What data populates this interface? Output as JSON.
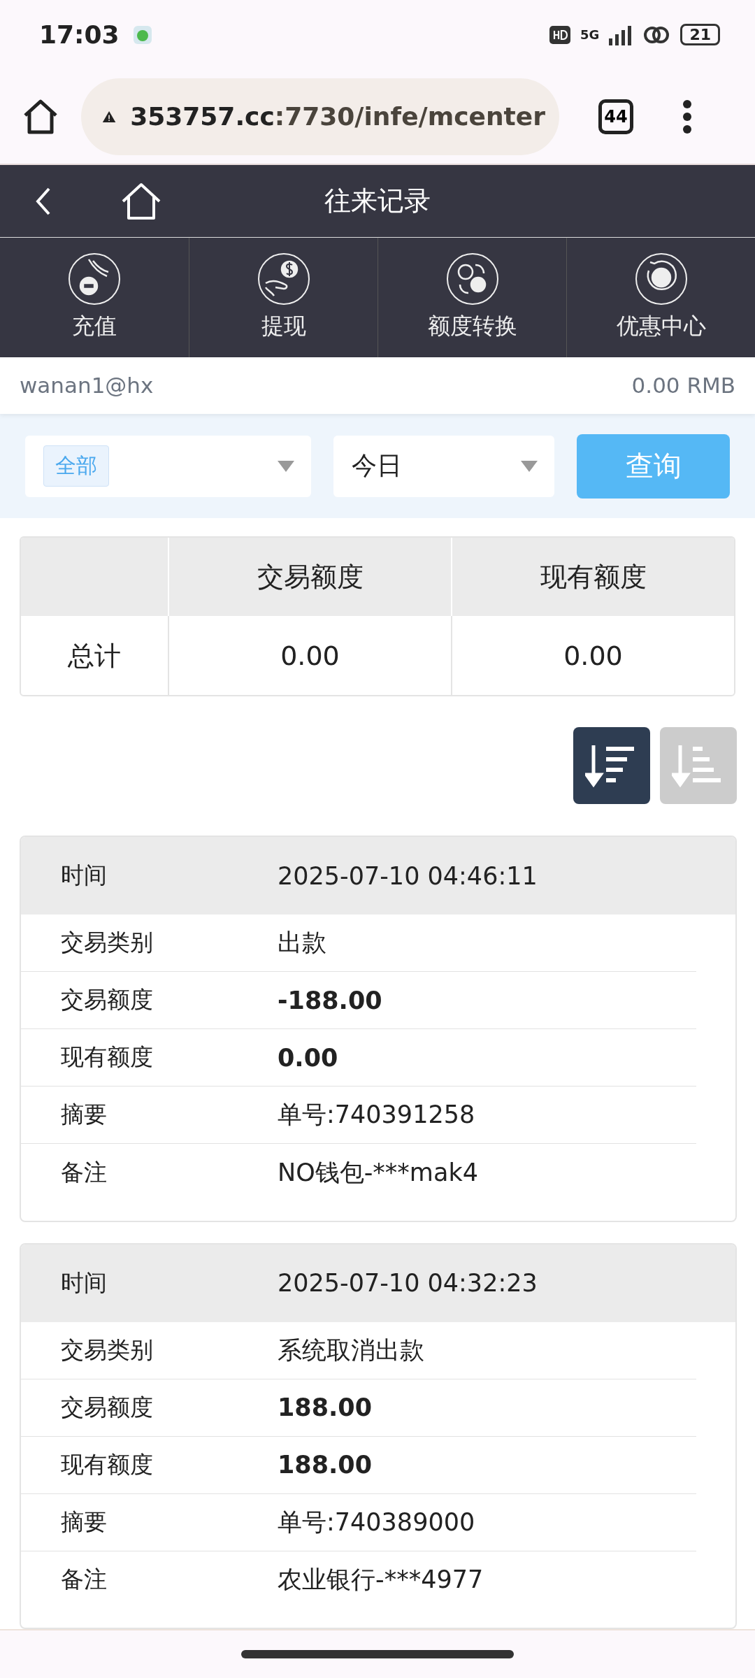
{
  "status_bar": {
    "time": "17:03",
    "network": "5G",
    "battery": "21"
  },
  "browser": {
    "url_host": "353757.cc",
    "url_path": ":7730/infe/mcenter",
    "tab_count": "44"
  },
  "header": {
    "title": "往来记录"
  },
  "nav": [
    {
      "label": "充值",
      "kind": "deposit"
    },
    {
      "label": "提现",
      "kind": "withdraw"
    },
    {
      "label": "额度转换",
      "kind": "transfer"
    },
    {
      "label": "优惠中心",
      "kind": "promo"
    }
  ],
  "account": {
    "username": "wanan1@hx",
    "balance": "0.00 RMB"
  },
  "filters": {
    "type_tag": "全部",
    "period": "今日",
    "query_button": "查询"
  },
  "summary": {
    "columns": [
      "交易额度",
      "现有额度"
    ],
    "row_label": "总计",
    "values": [
      "0.00",
      "0.00"
    ]
  },
  "sort_buttons": [
    {
      "kind": "desc",
      "selected": true
    },
    {
      "kind": "asc",
      "selected": false
    }
  ],
  "records": [
    {
      "time_label": "时间",
      "time": "2025-07-10 04:46:11",
      "fields": [
        {
          "label": "交易类别",
          "value": "出款",
          "bold": false
        },
        {
          "label": "交易额度",
          "value": "-188.00",
          "bold": true
        },
        {
          "label": "现有额度",
          "value": "0.00",
          "bold": true
        },
        {
          "label": "摘要",
          "value": "单号:740391258",
          "bold": false
        },
        {
          "label": "备注",
          "value": "NO钱包-***mak4",
          "bold": false
        }
      ]
    },
    {
      "time_label": "时间",
      "time": "2025-07-10 04:32:23",
      "fields": [
        {
          "label": "交易类别",
          "value": "系统取消出款",
          "bold": false
        },
        {
          "label": "交易额度",
          "value": "188.00",
          "bold": true
        },
        {
          "label": "现有额度",
          "value": "188.00",
          "bold": true
        },
        {
          "label": "摘要",
          "value": "单号:740389000",
          "bold": false
        },
        {
          "label": "备注",
          "value": "农业银行-***4977",
          "bold": false
        }
      ]
    }
  ]
}
